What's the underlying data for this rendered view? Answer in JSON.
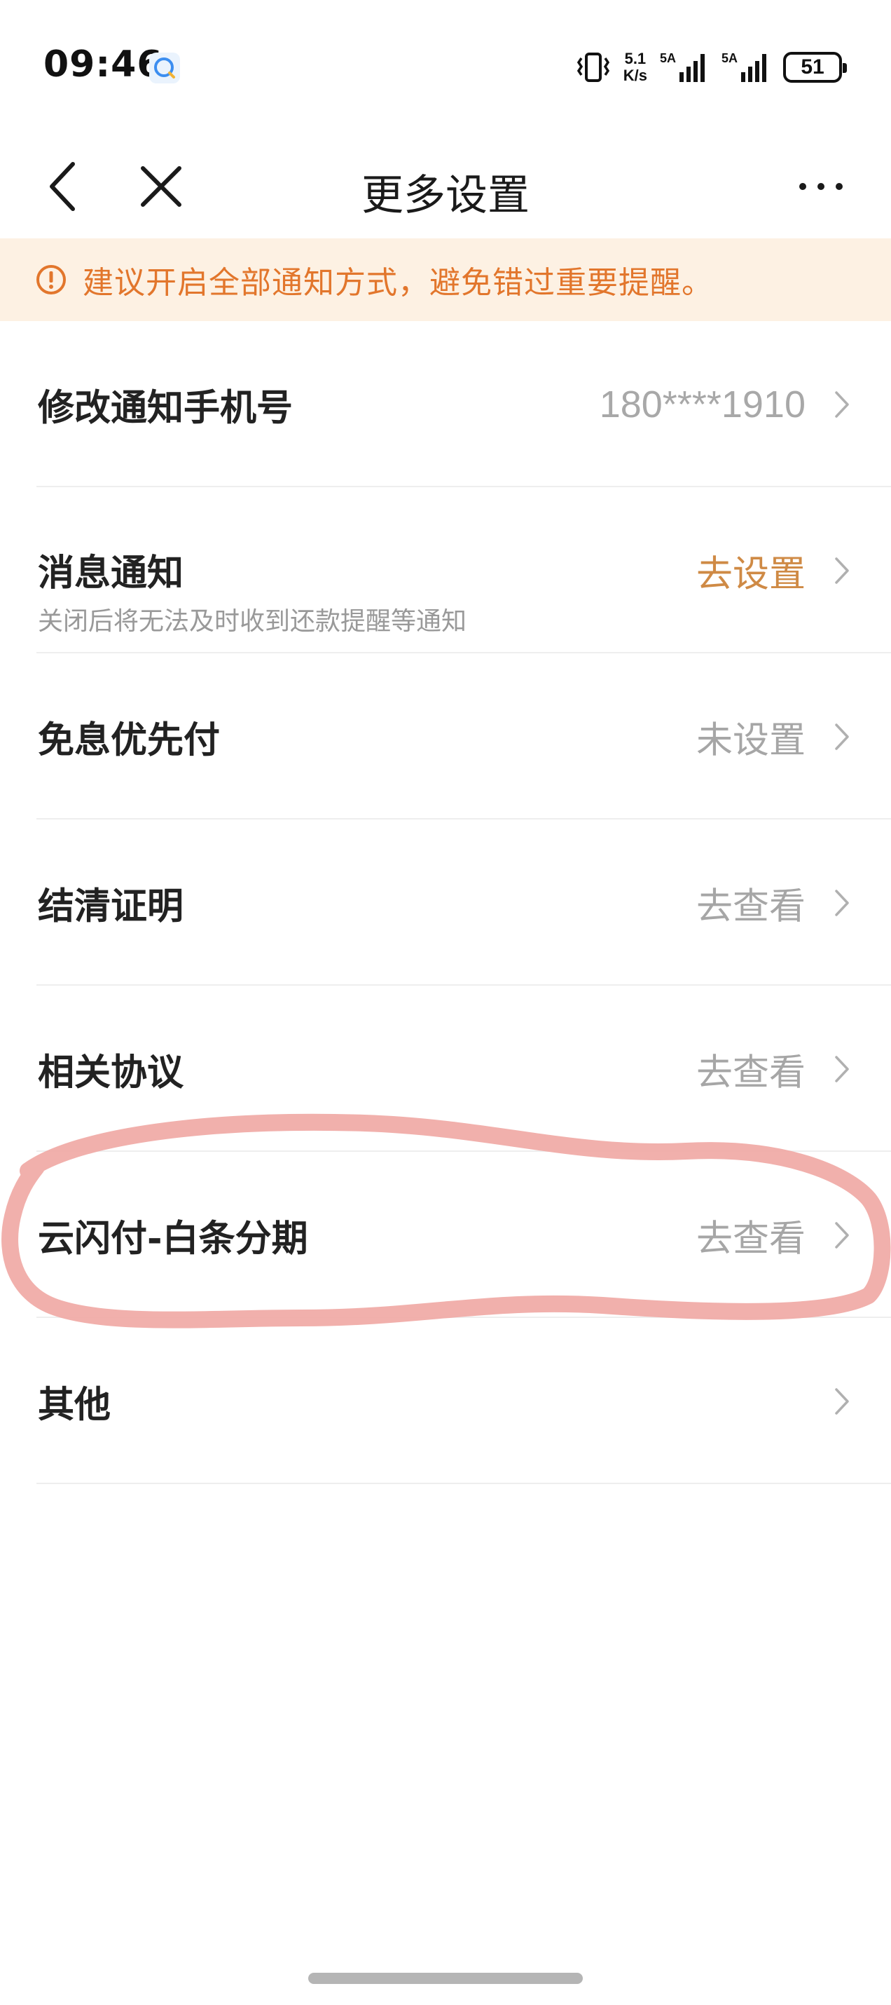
{
  "status_bar": {
    "time": "09:46",
    "net_speed_value": "5.1",
    "net_speed_unit": "K/s",
    "signal_1": "5A",
    "signal_2": "5A",
    "battery_level": "51",
    "icons": [
      "chat-app-icon",
      "vibrate-icon",
      "signal-icon",
      "battery-icon"
    ]
  },
  "nav": {
    "title": "更多设置",
    "icons": [
      "back-icon",
      "close-icon",
      "more-icon"
    ]
  },
  "notice": {
    "text": "建议开启全部通知方式，避免错过重要提醒。",
    "icon": "warning-icon",
    "color": "#e2762c",
    "background": "#fdf1e3"
  },
  "settings": [
    {
      "label": "修改通知手机号",
      "value": "180****1910"
    },
    {
      "label": "消息通知",
      "subtitle": "关闭后将无法及时收到还款提醒等通知",
      "value": "去设置"
    },
    {
      "label": "免息优先付",
      "value": "未设置"
    },
    {
      "label": "结清证明",
      "value": "去查看"
    },
    {
      "label": "相关协议",
      "value": "去查看"
    },
    {
      "label": "云闪付-白条分期",
      "value": "去查看"
    },
    {
      "label": "其他",
      "value": ""
    }
  ],
  "colors": {
    "accent_value": "#cf8a45",
    "muted_value": "#a6a6a6",
    "highlight_stroke": "#f0a7a3"
  }
}
